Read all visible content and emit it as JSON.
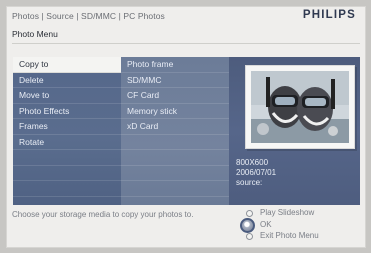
{
  "breadcrumb": "Photos | Source | SD/MMC | PC Photos",
  "brand": "PHILIPS",
  "menu_title": "Photo Menu",
  "menu_items": [
    "Copy to",
    "Delete",
    "Move to",
    "Photo Effects",
    "Frames",
    "Rotate"
  ],
  "selected_menu_item": "Copy to",
  "destinations": [
    "Photo frame",
    "SD/MMC",
    "CF Card",
    "Memory stick",
    "xD Card"
  ],
  "photo_info": {
    "resolution": "800X600",
    "date": "2006/07/01",
    "source_label": "source:"
  },
  "hint": "Choose your storage media to copy your photos to.",
  "options": [
    "Play Slideshow",
    "OK",
    "Exit Photo Menu"
  ],
  "colors": {
    "menu_panel": "#55678a",
    "submenu_panel": "#6c7c98",
    "preview_panel": "#4d5c7d",
    "brand": "#2f3950"
  }
}
